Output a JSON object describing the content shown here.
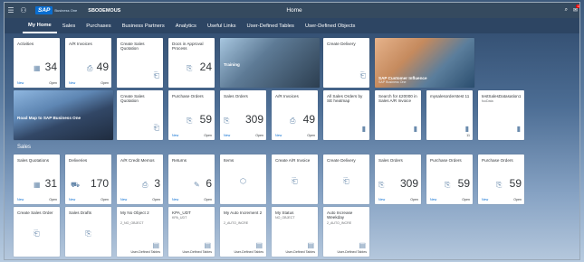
{
  "shell": {
    "logo": "SAP",
    "logo_sub": "Business One",
    "company": "SBODEMOUS",
    "title": "Home",
    "notification_count": "17"
  },
  "tabs": [
    "My Home",
    "Sales",
    "Purchases",
    "Business Partners",
    "Analytics",
    "Useful Links",
    "User-Defined Tables",
    "User-Defined Objects"
  ],
  "section_title": "Sales",
  "row1": {
    "activities": {
      "title": "Activities",
      "value": "34",
      "new": "New",
      "open": "Open"
    },
    "ar_invoices": {
      "title": "A/R Invoices",
      "value": "49",
      "new": "New",
      "open": "Open"
    },
    "create_sq": {
      "title": "Create Sales Quotation"
    },
    "docs_approval": {
      "title": "Docs in Approval Process",
      "value": "24"
    },
    "training": {
      "caption": "Training"
    },
    "create_delivery": {
      "title": "Create Delivery"
    },
    "customer_influence": {
      "caption": "SAP Customer Influence",
      "sub": "SAP Business One"
    }
  },
  "row2": {
    "roadmap": {
      "caption": "Road Map to SAP Business One"
    },
    "create_sq2": {
      "title": "Create Sales Quotation"
    },
    "purchase_orders": {
      "title": "Purchase Orders",
      "value": "59",
      "new": "New",
      "open": "Open"
    },
    "sales_orders": {
      "title": "Sales Orders",
      "value": "309",
      "new": "New",
      "open": "Open"
    },
    "ar_invoices2": {
      "title": "A/R Invoices",
      "value": "49",
      "new": "New",
      "open": "Open"
    },
    "all_sales_orders": {
      "title": "All Sales Orders by SE heatmap"
    },
    "search": {
      "title": "Search for £20000 in Sales A/R Invoice"
    },
    "mysalesorders": {
      "title": "mysalesorderstest 11",
      "footer": "11"
    },
    "testsales": {
      "title": "testSalesDatasation1",
      "sub": "fooData"
    }
  },
  "row3": {
    "sales_quotations": {
      "title": "Sales Quotations",
      "value": "31",
      "new": "New",
      "open": "Open"
    },
    "deliveries": {
      "title": "Deliveries",
      "value": "170",
      "new": "New",
      "open": "Open"
    },
    "ar_credit": {
      "title": "A/R Credit Memos",
      "value": "3",
      "new": "New",
      "open": "Open"
    },
    "returns": {
      "title": "Returns",
      "value": "6",
      "new": "New",
      "open": "Open"
    },
    "items": {
      "title": "Items"
    },
    "create_ar": {
      "title": "Create A/R Invoice"
    },
    "create_delivery2": {
      "title": "Create Delivery"
    },
    "sales_orders2": {
      "title": "Sales Orders",
      "value": "309",
      "new": "New",
      "open": "Open"
    },
    "purchase_orders2": {
      "title": "Purchase Orders",
      "value": "59",
      "new": "New",
      "open": "Open"
    },
    "purchase_orders3": {
      "title": "Purchase Orders",
      "value": "59",
      "new": "New",
      "open": "Open"
    }
  },
  "row4": {
    "create_so": {
      "title": "Create Sales Order"
    },
    "sales_drafts": {
      "title": "Sales Drafts"
    },
    "my_no_object": {
      "title": "My No Object 2",
      "sub": "2_NO_OBJECT",
      "footer": "User-Defined Tables"
    },
    "kpa_udt": {
      "title": "KPA_UDT",
      "sub": "KPA_UDT",
      "footer": "User-Defined Tables"
    },
    "my_auto_inc": {
      "title": "My Auto Increment 2",
      "sub": "2_AUTO_INCRE",
      "footer": "User-Defined Tables"
    },
    "my_status": {
      "title": "My Status",
      "sub": "NO_OBJECT",
      "footer": "User-Defined Tables"
    },
    "auto_inc_weekday": {
      "title": "Auto Increase Weekday",
      "sub": "2_AUTO_INCRE",
      "footer": "User-Defined Tables"
    }
  },
  "colors": {
    "shell": "#354a5f",
    "accent": "#0a6ed1",
    "icon": "#6a8bad"
  }
}
